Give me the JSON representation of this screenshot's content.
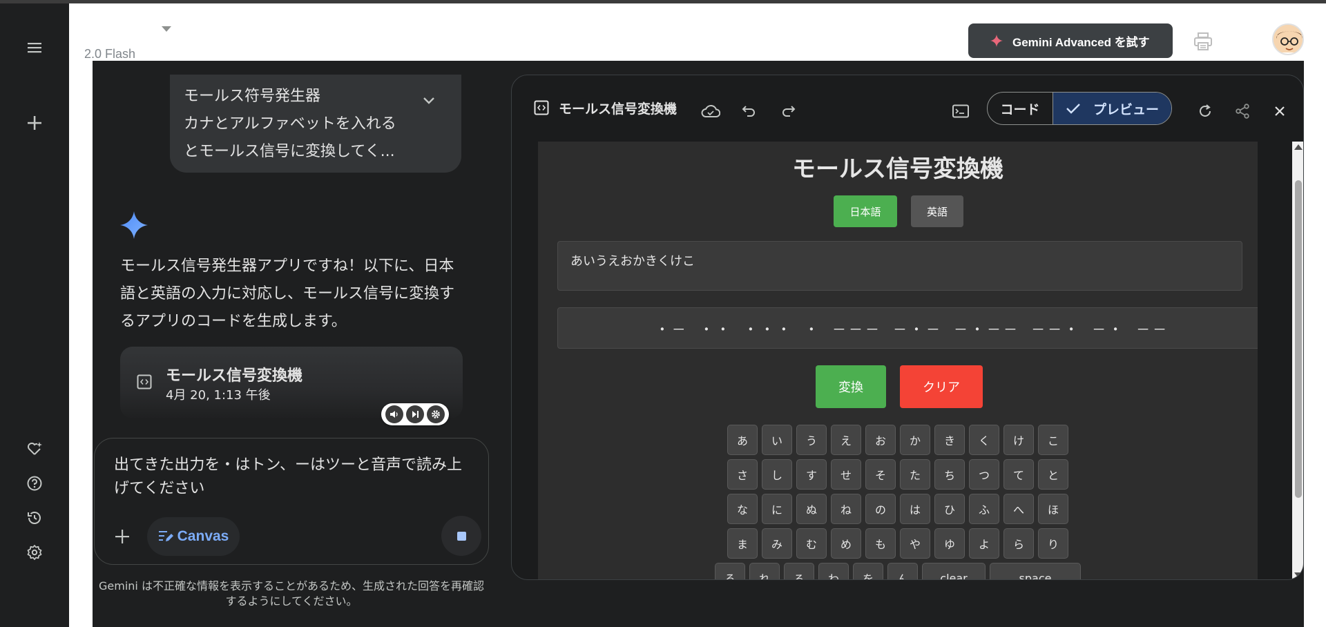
{
  "header": {
    "model_label": "2.0 Flash",
    "advanced_button": "Gemini Advanced を試す"
  },
  "colors": {
    "accent_blue": "#a8c7fa",
    "canvas_blue": "#7cacf8",
    "green": "#4caf50",
    "red": "#f44336"
  },
  "sidebar": {
    "icons": [
      "menu-icon",
      "new-chat-icon",
      "gem-icon",
      "help-icon",
      "activity-icon",
      "settings-icon"
    ]
  },
  "chat": {
    "user_prompt": {
      "line1": "モールス符号発生器",
      "line2": "カナとアルファベットを入れる",
      "line3": "とモールス信号に変換してく..."
    },
    "reply": "モールス信号発生器アプリですね！以下に、日本語と英語の入力に対応し、モールス信号に変換するアプリのコードを生成します。",
    "card": {
      "title": "モールス信号変換機",
      "date": "4月 20, 1:13 午後"
    },
    "input_text": "出てきた出力を・はトン、ーはツーと音声で読み上げてください",
    "canvas_label": "Canvas",
    "disclaimer": "Gemini は不正確な情報を表示することがあるため、生成された回答を再確認するようにしてください。"
  },
  "panel": {
    "title": "モールス信号変換機",
    "toggle": {
      "code": "コード",
      "preview": "プレビュー"
    }
  },
  "app": {
    "title": "モールス信号変換機",
    "lang_japanese": "日本語",
    "lang_english": "英語",
    "input_value": "あいうえおかきくけこ",
    "morse_output": "・－ ・・ ・・・ ・ －－－ －・－ －・－－ －－・ －・ －－",
    "convert_label": "変換",
    "clear_label": "クリア",
    "keyboard_rows": [
      [
        "あ",
        "い",
        "う",
        "え",
        "お",
        "か",
        "き",
        "く",
        "け",
        "こ"
      ],
      [
        "さ",
        "し",
        "す",
        "せ",
        "そ",
        "た",
        "ち",
        "つ",
        "て",
        "と"
      ],
      [
        "な",
        "に",
        "ぬ",
        "ね",
        "の",
        "は",
        "ひ",
        "ふ",
        "へ",
        "ほ"
      ],
      [
        "ま",
        "み",
        "む",
        "め",
        "も",
        "や",
        "ゆ",
        "よ",
        "ら",
        "り"
      ]
    ],
    "keyboard_last_row": [
      "る",
      "れ",
      "ろ",
      "わ",
      "を",
      "ん"
    ],
    "key_clear": "clear",
    "key_space": "space"
  }
}
